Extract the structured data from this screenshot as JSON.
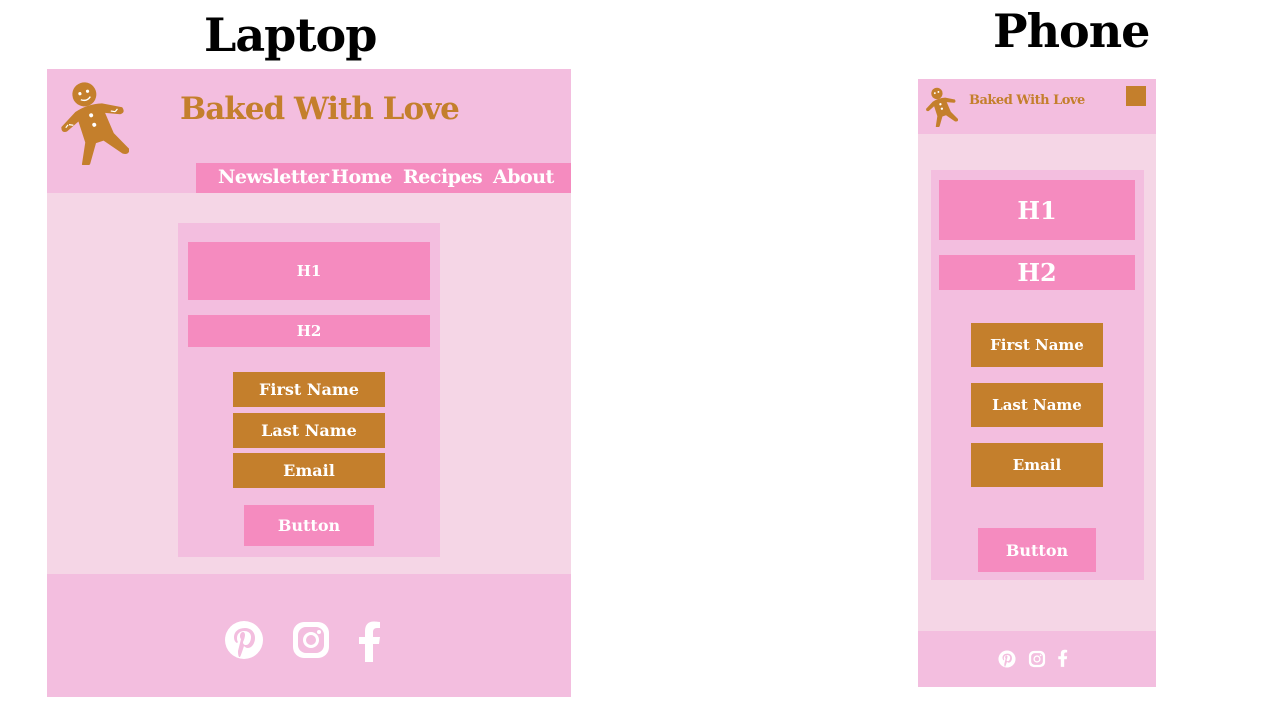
{
  "labels": {
    "laptop": "Laptop",
    "phone": "Phone"
  },
  "site": {
    "title": "Baked With Love"
  },
  "nav": [
    {
      "label": "Newsletter"
    },
    {
      "label": "Home"
    },
    {
      "label": "Recipes"
    },
    {
      "label": "About"
    }
  ],
  "form": {
    "h1": "H1",
    "h2": "H2",
    "fields": [
      "First Name",
      "Last Name",
      "Email"
    ],
    "button": "Button"
  },
  "footer": {
    "icons": [
      "pinterest-icon",
      "instagram-icon",
      "facebook-icon"
    ]
  },
  "colors": {
    "header_bg": "#f3bedf",
    "body_bg": "#f5d6e6",
    "accent_pink": "#f58bbf",
    "accent_gold": "#c47f2c"
  }
}
